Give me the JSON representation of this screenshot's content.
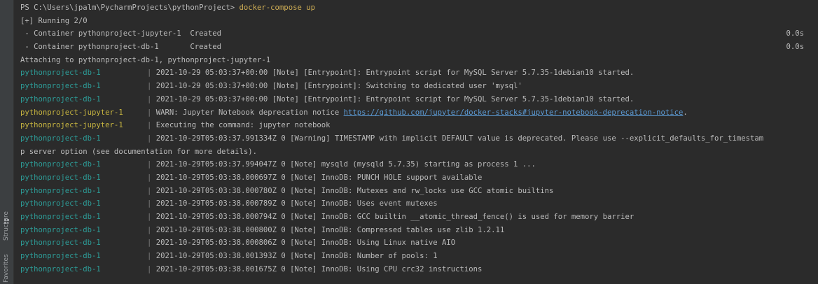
{
  "sidebar": {
    "structure_label": "Structure",
    "favorites_label": "Favorites"
  },
  "terminal": {
    "prompt": "PS C:\\Users\\jpalm\\PycharmProjects\\pythonProject> ",
    "command": "docker-compose up",
    "running": "[+] Running 2/0",
    "containers": [
      {
        "name": " - Container pythonproject-jupyter-1  ",
        "status": "Created",
        "time": "0.0s"
      },
      {
        "name": " - Container pythonproject-db-1       ",
        "status": "Created",
        "time": "0.0s"
      }
    ],
    "attaching": "Attaching to pythonproject-db-1, pythonproject-jupyter-1",
    "logs": [
      {
        "service": "pythonproject-db-1",
        "kind": "db",
        "msg": "2021-10-29 05:03:37+00:00 [Note] [Entrypoint]: Entrypoint script for MySQL Server 5.7.35-1debian10 started."
      },
      {
        "service": "pythonproject-db-1",
        "kind": "db",
        "msg": "2021-10-29 05:03:37+00:00 [Note] [Entrypoint]: Switching to dedicated user 'mysql'"
      },
      {
        "service": "pythonproject-db-1",
        "kind": "db",
        "msg": "2021-10-29 05:03:37+00:00 [Note] [Entrypoint]: Entrypoint script for MySQL Server 5.7.35-1debian10 started."
      },
      {
        "service": "pythonproject-jupyter-1",
        "kind": "jup",
        "msg": "WARN: Jupyter Notebook deprecation notice ",
        "link": "https://github.com/jupyter/docker-stacks#jupyter-notebook-deprecation-notice",
        "after": "."
      },
      {
        "service": "pythonproject-jupyter-1",
        "kind": "jup",
        "msg": "Executing the command: jupyter notebook"
      },
      {
        "service": "pythonproject-db-1",
        "kind": "db",
        "msg": "2021-10-29T05:03:37.991334Z 0 [Warning] TIMESTAMP with implicit DEFAULT value is deprecated. Please use --explicit_defaults_for_timestam"
      },
      {
        "continuation": "p server option (see documentation for more details)."
      },
      {
        "service": "pythonproject-db-1",
        "kind": "db",
        "msg": "2021-10-29T05:03:37.994047Z 0 [Note] mysqld (mysqld 5.7.35) starting as process 1 ..."
      },
      {
        "service": "pythonproject-db-1",
        "kind": "db",
        "msg": "2021-10-29T05:03:38.000697Z 0 [Note] InnoDB: PUNCH HOLE support available"
      },
      {
        "service": "pythonproject-db-1",
        "kind": "db",
        "msg": "2021-10-29T05:03:38.000780Z 0 [Note] InnoDB: Mutexes and rw_locks use GCC atomic builtins"
      },
      {
        "service": "pythonproject-db-1",
        "kind": "db",
        "msg": "2021-10-29T05:03:38.000789Z 0 [Note] InnoDB: Uses event mutexes"
      },
      {
        "service": "pythonproject-db-1",
        "kind": "db",
        "msg": "2021-10-29T05:03:38.000794Z 0 [Note] InnoDB: GCC builtin __atomic_thread_fence() is used for memory barrier"
      },
      {
        "service": "pythonproject-db-1",
        "kind": "db",
        "msg": "2021-10-29T05:03:38.000800Z 0 [Note] InnoDB: Compressed tables use zlib 1.2.11"
      },
      {
        "service": "pythonproject-db-1",
        "kind": "db",
        "msg": "2021-10-29T05:03:38.000806Z 0 [Note] InnoDB: Using Linux native AIO"
      },
      {
        "service": "pythonproject-db-1",
        "kind": "db",
        "msg": "2021-10-29T05:03:38.001393Z 0 [Note] InnoDB: Number of pools: 1"
      },
      {
        "service": "pythonproject-db-1",
        "kind": "db",
        "msg": "2021-10-29T05:03:38.001675Z 0 [Note] InnoDB: Using CPU crc32 instructions"
      }
    ],
    "pipe": "| ",
    "colors": {
      "db_service": "#2d9d98",
      "jupyter_service": "#c7b540",
      "command": "#cfae55",
      "link": "#5c9bd5",
      "background": "#2b2b2b"
    }
  }
}
